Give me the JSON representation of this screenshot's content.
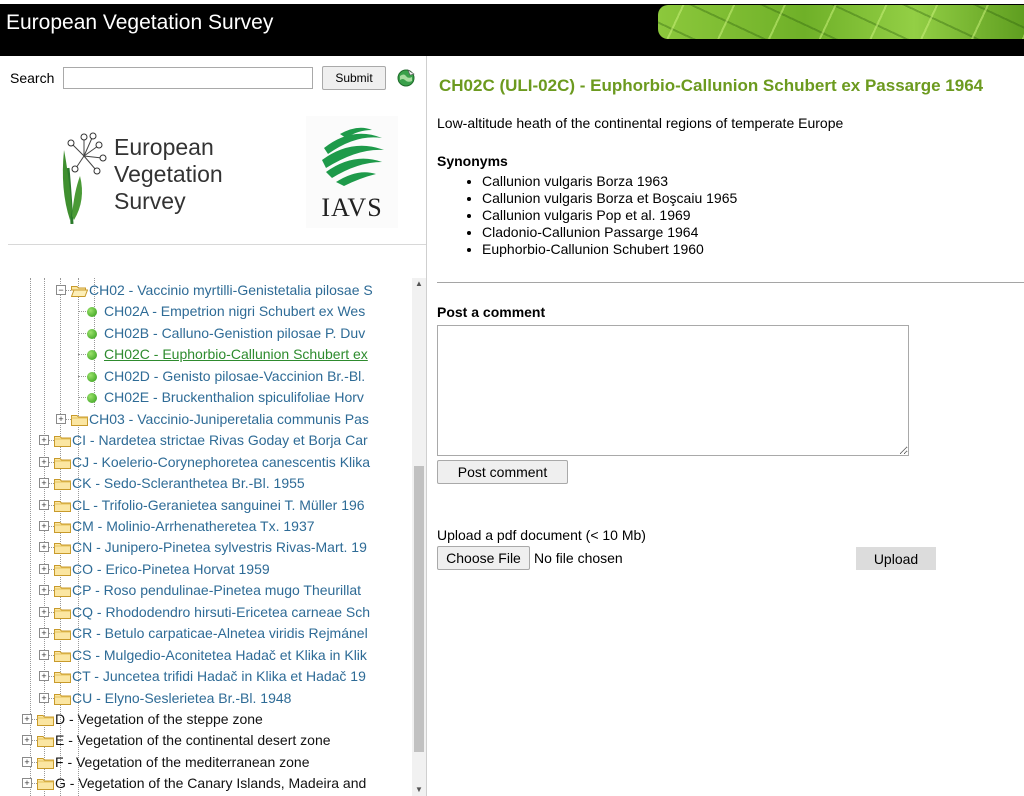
{
  "header": {
    "title": "European Vegetation Survey"
  },
  "search": {
    "label": "Search",
    "value": "",
    "submit_label": "Submit"
  },
  "logos": {
    "evs_lines": [
      "European",
      "Vegetation",
      "Survey"
    ],
    "iavs_text": "IAVS"
  },
  "tree": {
    "rows": [
      {
        "label": "CH02 - Vaccinio myrtilli-Genistetalia pilosae S",
        "kind": "folder",
        "state": "expanded",
        "level": 4,
        "style": "link"
      },
      {
        "label": "CH02A - Empetrion nigri Schubert ex Wes",
        "kind": "leaf",
        "level": 5,
        "style": "link"
      },
      {
        "label": "CH02B - Calluno-Genistion pilosae P. Duv",
        "kind": "leaf",
        "level": 5,
        "style": "link"
      },
      {
        "label": "CH02C - Euphorbio-Callunion Schubert ex",
        "kind": "leaf",
        "level": 5,
        "style": "active"
      },
      {
        "label": "CH02D - Genisto pilosae-Vaccinion Br.-Bl.",
        "kind": "leaf",
        "level": 5,
        "style": "link"
      },
      {
        "label": "CH02E - Bruckenthalion spiculifoliae Horv",
        "kind": "leaf",
        "level": 5,
        "style": "link"
      },
      {
        "label": "CH03 - Vaccinio-Juniperetalia communis Pas",
        "kind": "folder",
        "state": "collapsed",
        "level": 4,
        "style": "link"
      },
      {
        "label": "CI - Nardetea strictae Rivas Goday et Borja Car",
        "kind": "folder",
        "state": "collapsed",
        "level": 3,
        "style": "link"
      },
      {
        "label": "CJ - Koelerio-Corynephoretea canescentis Klika",
        "kind": "folder",
        "state": "collapsed",
        "level": 3,
        "style": "link"
      },
      {
        "label": "CK - Sedo-Scleranthetea Br.-Bl. 1955",
        "kind": "folder",
        "state": "collapsed",
        "level": 3,
        "style": "link"
      },
      {
        "label": "CL - Trifolio-Geranietea sanguinei T. Müller 196",
        "kind": "folder",
        "state": "collapsed",
        "level": 3,
        "style": "link"
      },
      {
        "label": "CM - Molinio-Arrhenatheretea Tx. 1937",
        "kind": "folder",
        "state": "collapsed",
        "level": 3,
        "style": "link"
      },
      {
        "label": "CN - Junipero-Pinetea sylvestris Rivas-Mart. 19",
        "kind": "folder",
        "state": "collapsed",
        "level": 3,
        "style": "link"
      },
      {
        "label": "CO - Erico-Pinetea Horvat 1959",
        "kind": "folder",
        "state": "collapsed",
        "level": 3,
        "style": "link"
      },
      {
        "label": "CP - Roso pendulinae-Pinetea mugo Theurillat",
        "kind": "folder",
        "state": "collapsed",
        "level": 3,
        "style": "link"
      },
      {
        "label": "CQ - Rhododendro hirsuti-Ericetea carneae Sch",
        "kind": "folder",
        "state": "collapsed",
        "level": 3,
        "style": "link"
      },
      {
        "label": "CR - Betulo carpaticae-Alnetea viridis Rejmánel",
        "kind": "folder",
        "state": "collapsed",
        "level": 3,
        "style": "link"
      },
      {
        "label": "CS - Mulgedio-Aconitetea Hadač et Klika in Klik",
        "kind": "folder",
        "state": "collapsed",
        "level": 3,
        "style": "link"
      },
      {
        "label": "CT - Juncetea trifidi Hadač in Klika et Hadač 19",
        "kind": "folder",
        "state": "collapsed",
        "level": 3,
        "style": "link"
      },
      {
        "label": "CU - Elyno-Seslerietea Br.-Bl. 1948",
        "kind": "folder",
        "state": "collapsed",
        "level": 3,
        "style": "link"
      },
      {
        "label": "D - Vegetation of the steppe zone",
        "kind": "folder",
        "state": "collapsed",
        "level": 2,
        "style": "dark"
      },
      {
        "label": "E - Vegetation of the continental desert zone",
        "kind": "folder",
        "state": "collapsed",
        "level": 2,
        "style": "dark"
      },
      {
        "label": "F - Vegetation of the mediterranean zone",
        "kind": "folder",
        "state": "collapsed",
        "level": 2,
        "style": "dark"
      },
      {
        "label": "G - Vegetation of the Canary Islands, Madeira and",
        "kind": "folder",
        "state": "collapsed",
        "level": 2,
        "style": "dark"
      }
    ]
  },
  "detail": {
    "title": "CH02C (ULI-02C) - Euphorbio-Callunion Schubert ex Passarge 1964",
    "description": "Low-altitude heath of the continental regions of temperate Europe",
    "synonyms_heading": "Synonyms",
    "synonyms": [
      "Callunion vulgaris Borza 1963",
      "Callunion vulgaris Borza et Boşcaiu 1965",
      "Callunion vulgaris Pop et al. 1969",
      "Cladonio-Callunion Passarge 1964",
      "Euphorbio-Callunion Schubert 1960"
    ],
    "comment_heading": "Post a comment",
    "comment_value": "",
    "post_button": "Post comment",
    "upload_label": "Upload a pdf document (< 10 Mb)",
    "choose_button": "Choose File",
    "no_file_text": "No file chosen",
    "upload_button": "Upload"
  },
  "colors": {
    "title_green": "#6c9a1f",
    "tree_link": "#2e6b96",
    "tree_active": "#2e8b2e",
    "header_bg": "#000000"
  },
  "icons": [
    "globe-icon",
    "folder-icon",
    "leaf-node-icon",
    "expand-icon",
    "collapse-icon"
  ]
}
